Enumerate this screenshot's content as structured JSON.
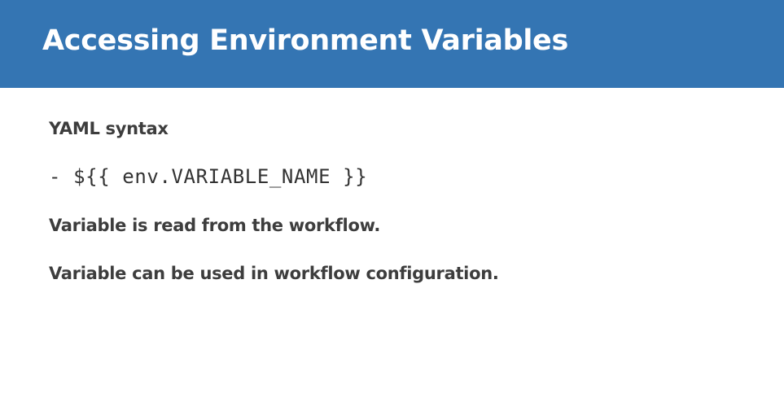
{
  "slide": {
    "title": "Accessing Environment Variables",
    "lines": [
      "YAML syntax",
      "- ${{ env.VARIABLE_NAME }}",
      "Variable is read from the workflow.",
      "Variable can be used in workflow configuration."
    ]
  },
  "colors": {
    "header_background": "#3475b3",
    "title_text": "#ffffff",
    "body_text": "#3d3d3d",
    "slide_background": "#ffffff"
  }
}
